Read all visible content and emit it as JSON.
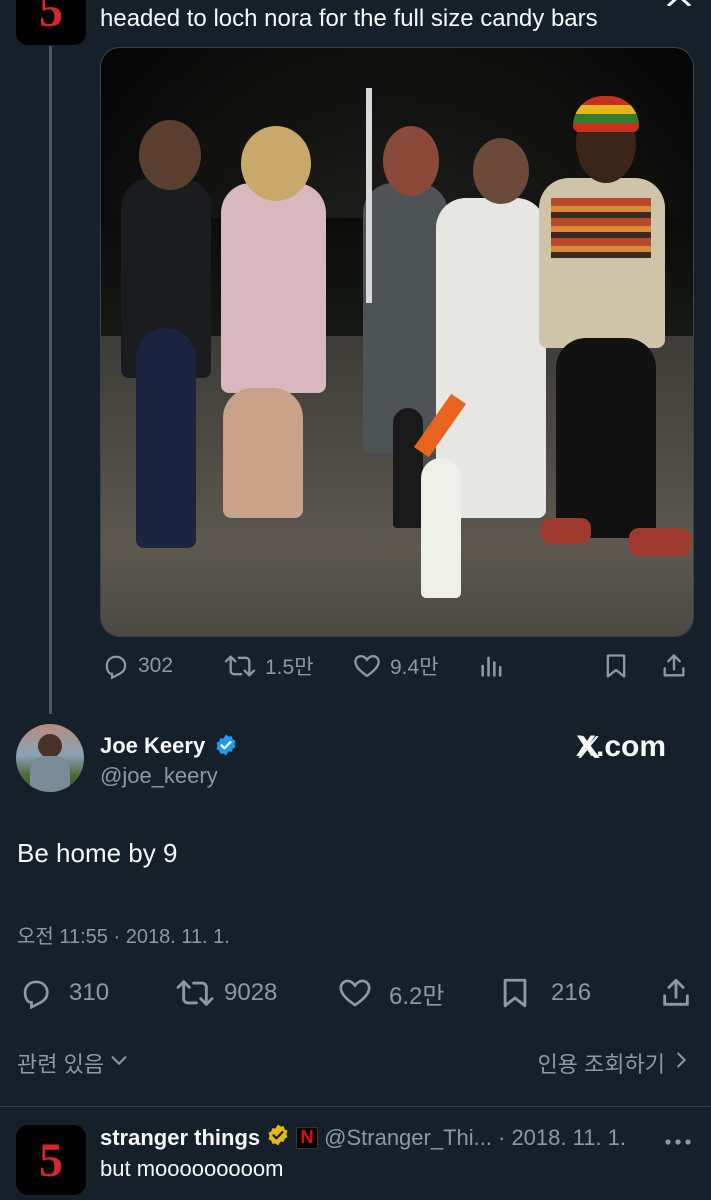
{
  "parent_tweet": {
    "avatar_text": "5",
    "text": "headed to loch nora for the full size candy bars",
    "stats": {
      "replies": "302",
      "retweets": "1.5만",
      "likes": "9.4만"
    }
  },
  "main_tweet": {
    "author_name": "Joe Keery",
    "author_handle": "@joe_keery",
    "watermark": "X.com",
    "text": "Be home by 9",
    "timestamp": "오전 11:55 · 2018. 11. 1.",
    "stats": {
      "replies": "310",
      "retweets": "9028",
      "likes": "6.2만",
      "bookmarks": "216"
    },
    "related_label": "관련 있음",
    "quotes_label": "인용 조회하기"
  },
  "reply_tweet": {
    "avatar_text": "5",
    "author_name": "stranger things",
    "netflix_badge": "N",
    "author_handle": "@Stranger_Thi...",
    "date": "· 2018. 11. 1.",
    "text": "but mooooooooom"
  },
  "colors": {
    "background": "#15202b",
    "muted": "#8b98a5",
    "verified_blue": "#1d9bf0",
    "verified_gold": "#e2b719",
    "netflix_red": "#e50914"
  }
}
